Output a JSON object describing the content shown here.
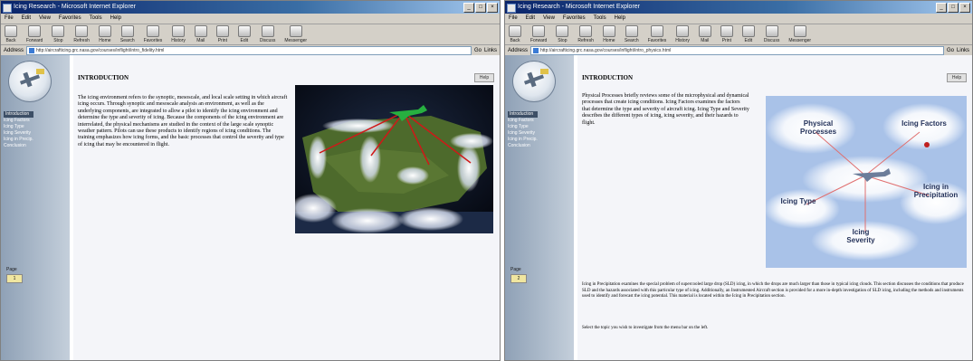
{
  "window_left": {
    "title": "Icing Research - Microsoft Internet Explorer",
    "menu": [
      "File",
      "Edit",
      "View",
      "Favorites",
      "Tools",
      "Help"
    ],
    "toolbar": [
      "Back",
      "Forward",
      "Stop",
      "Refresh",
      "Home",
      "Search",
      "Favorites",
      "History",
      "Mail",
      "Print",
      "Edit",
      "Discuss",
      "Messenger"
    ],
    "address_label": "Address",
    "url": "http://aircrafticing.grc.nasa.gov/courses/inflight/intro_fidelity.html",
    "go_label": "Go",
    "links_label": "Links",
    "sidebar": {
      "nav": [
        "Introduction",
        "Icing Factors",
        "Icing Type",
        "Icing Severity",
        "Icing in Precip.",
        "Conclusion"
      ],
      "page_label": "Page",
      "page_value": "1"
    },
    "page_title": "INTRODUCTION",
    "help_label": "Help",
    "body": "The icing environment refers to the synoptic, mesoscale, and local scale setting in which aircraft icing occurs. Through synoptic and mesoscale analysis an environment, as well as the underlying components, are integrated to allow a pilot to identify the icing environment and determine the type and severity of icing. Because the components of the icing environment are interrelated, the physical mechanisms are studied in the context of the large scale synoptic weather pattern. Pilots can use these products to identify regions of icing conditions. The training emphasizes how icing forms, and the basic processes that control the severity and type of icing that may be encountered in flight."
  },
  "window_right": {
    "title": "Icing Research - Microsoft Internet Explorer",
    "menu": [
      "File",
      "Edit",
      "View",
      "Favorites",
      "Tools",
      "Help"
    ],
    "toolbar": [
      "Back",
      "Forward",
      "Stop",
      "Refresh",
      "Home",
      "Search",
      "Favorites",
      "History",
      "Mail",
      "Print",
      "Edit",
      "Discuss",
      "Messenger"
    ],
    "address_label": "Address",
    "url": "http://aircrafticing.grc.nasa.gov/courses/inflight/intro_physics.html",
    "go_label": "Go",
    "links_label": "Links",
    "sidebar": {
      "nav": [
        "Introduction",
        "Icing Factors",
        "Icing Type",
        "Icing Severity",
        "Icing in Precip.",
        "Conclusion"
      ],
      "page_label": "Page",
      "page_value": "2"
    },
    "page_title": "INTRODUCTION",
    "help_label": "Help",
    "body_top": "Physical Processes briefly reviews some of the microphysical and dynamical processes that create icing conditions. Icing Factors examines the factors that determine the type and severity of aircraft icing. Icing Type and Severity describes the different types of icing, icing severity, and their hazards to flight.",
    "body_bottom": "Icing in Precipitation examines the special problem of supercooled large drop (SLD) icing, in which the drops are much larger than those in typical icing clouds. This section discusses the conditions that produce SLD and the hazards associated with this particular type of icing. Additionally, an Instrumented Aircraft section is provided for a more in-depth investigation of SLD icing, including the methods and instruments used to identify and forecast the icing potential. This material is located within the Icing in Precipitation section.",
    "body_hint": "Select the topic you wish to investigate from the menu bar on the left.",
    "diagram_labels": {
      "physical": "Physical Processes",
      "factors": "Icing Factors",
      "type": "Icing Type",
      "severity": "Icing Severity",
      "precip": "Icing in Precipitation"
    }
  }
}
